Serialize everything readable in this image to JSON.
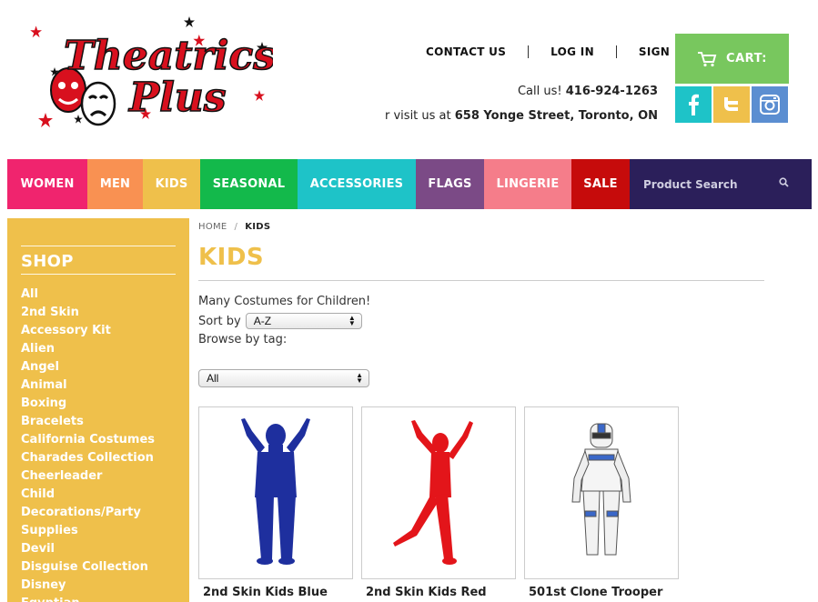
{
  "header": {
    "logo_text_line1": "Theatrics",
    "logo_text_line2": "Plus",
    "links": [
      "CONTACT US",
      "LOG IN",
      "SIGN"
    ],
    "call_label": "Call us!",
    "phone": "416-924-1263",
    "visit_label": "r visit us at",
    "address": "658 Yonge Street, Toronto, ON",
    "cart_label": "CART:"
  },
  "social": [
    "facebook-icon",
    "twitter-icon",
    "instagram-icon"
  ],
  "nav": {
    "items": [
      "WOMEN",
      "MEN",
      "KIDS",
      "SEASONAL",
      "ACCESSORIES",
      "FLAGS",
      "LINGERIE",
      "SALE"
    ],
    "search_placeholder": "Product Search"
  },
  "sidebar": {
    "title": "SHOP",
    "items": [
      "All",
      "2nd Skin",
      "Accessory Kit",
      "Alien",
      "Angel",
      "Animal",
      "Boxing",
      "Bracelets",
      "California Costumes",
      "Charades Collection",
      "Cheerleader",
      "Child",
      "Decorations/Party",
      "Supplies",
      "Devil",
      "Disguise Collection",
      "Disney",
      "Egyptian"
    ]
  },
  "main": {
    "breadcrumb": {
      "home": "HOME",
      "sep": "/",
      "current": "KIDS"
    },
    "title": "KIDS",
    "description": "Many Costumes for Children!",
    "sort_label": "Sort by",
    "sort_value": "A-Z",
    "browse_label": "Browse by tag:",
    "tag_value": "All",
    "products": [
      {
        "name": "2nd Skin Kids Blue"
      },
      {
        "name": "2nd Skin Kids Red"
      },
      {
        "name": "501st Clone Trooper"
      }
    ]
  },
  "colors": {
    "accent_yellow": "#efc04b",
    "cart_green": "#78c75e",
    "nav_dark": "#2b1f5a",
    "logo_red": "#d8101e"
  }
}
